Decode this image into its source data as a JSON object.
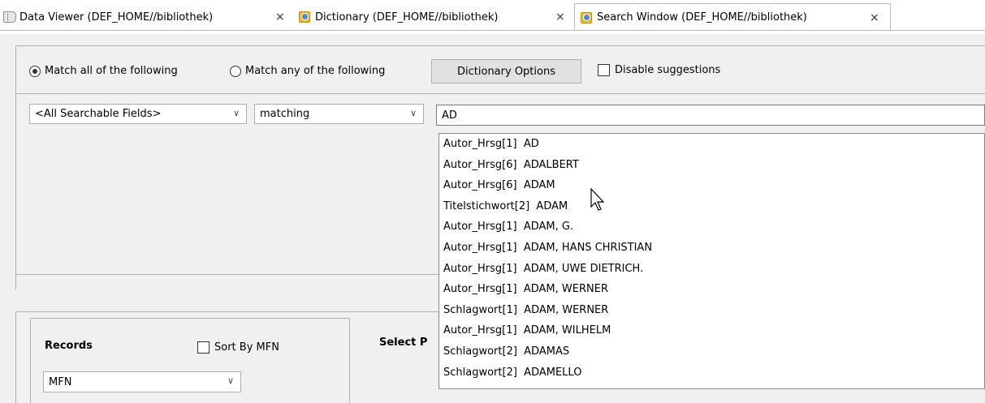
{
  "tabs": [
    {
      "label": "Data Viewer (DEF_HOME//bibliothek)",
      "icon": "book-icon",
      "close": "×"
    },
    {
      "label": "Dictionary (DEF_HOME//bibliothek)",
      "icon": "dictionary-icon",
      "close": "×"
    },
    {
      "label": "Search Window (DEF_HOME//bibliothek)",
      "icon": "dictionary-icon",
      "close": "×",
      "active": true
    }
  ],
  "options": {
    "match_all": "Match all of the following",
    "match_any": "Match any of the following",
    "selected": "match_all",
    "dictionary_button": "Dictionary Options",
    "disable_suggestions": "Disable suggestions"
  },
  "criteria": {
    "field": "<All Searchable Fields>",
    "operator": "matching",
    "value": "AD"
  },
  "suggestions": [
    "Autor_Hrsg[1]  AD",
    "Autor_Hrsg[6]  ADALBERT",
    "Autor_Hrsg[6]  ADAM",
    "Titelstichwort[2]  ADAM",
    "Autor_Hrsg[1]  ADAM, G.",
    "Autor_Hrsg[1]  ADAM, HANS CHRISTIAN",
    "Autor_Hrsg[1]  ADAM, UWE DIETRICH.",
    "Autor_Hrsg[1]  ADAM, WERNER",
    "Schlagwort[1]  ADAM, WERNER",
    "Autor_Hrsg[1]  ADAM, WILHELM",
    "Schlagwort[2]  ADAMAS",
    "Schlagwort[2]  ADAMELLO"
  ],
  "records": {
    "title": "Records",
    "sort_by_mfn": "Sort By MFN",
    "field": "MFN"
  },
  "select_label": "Select P",
  "colors": {
    "accent": "#3d8fdc",
    "dict_icon": "#f5b921"
  }
}
